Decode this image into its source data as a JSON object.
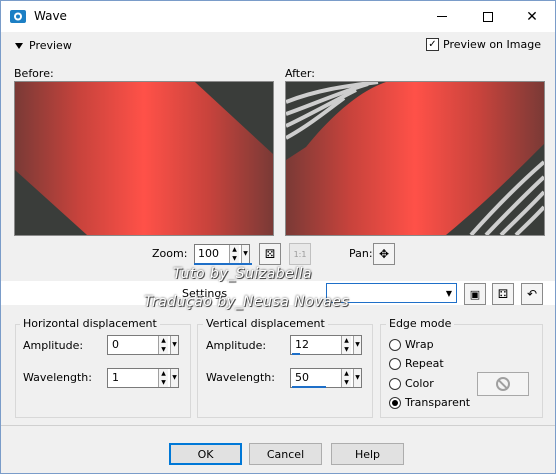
{
  "window": {
    "title": "Wave",
    "app_icon": "paint-shop-icon",
    "accent": "#0078d7"
  },
  "preview": {
    "toggle_label": "Preview",
    "preview_on_image_label": "Preview on Image",
    "preview_on_image_checked": true
  },
  "panes": {
    "before_label": "Before:",
    "after_label": "After:"
  },
  "zoom": {
    "label": "Zoom:",
    "value": "100",
    "pan_label": "Pan:"
  },
  "watermark": {
    "line1": "Tuto by_Suizabella",
    "line2": "Tradução by_Neusa Novaes"
  },
  "settings": {
    "label": "Settings",
    "selected": ""
  },
  "horizontal": {
    "title": "Horizontal displacement",
    "amplitude_label": "Amplitude:",
    "amplitude": "0",
    "wavelength_label": "Wavelength:",
    "wavelength": "1"
  },
  "vertical": {
    "title": "Vertical displacement",
    "amplitude_label": "Amplitude:",
    "amplitude": "12",
    "wavelength_label": "Wavelength:",
    "wavelength": "50"
  },
  "edge": {
    "title": "Edge mode",
    "options": [
      "Wrap",
      "Repeat",
      "Color",
      "Transparent"
    ],
    "selected": "Transparent"
  },
  "buttons": {
    "ok": "OK",
    "cancel": "Cancel",
    "help": "Help"
  },
  "colors": {
    "gradient_red": "#f84a42",
    "gradient_dark": "#3a3d3a"
  }
}
